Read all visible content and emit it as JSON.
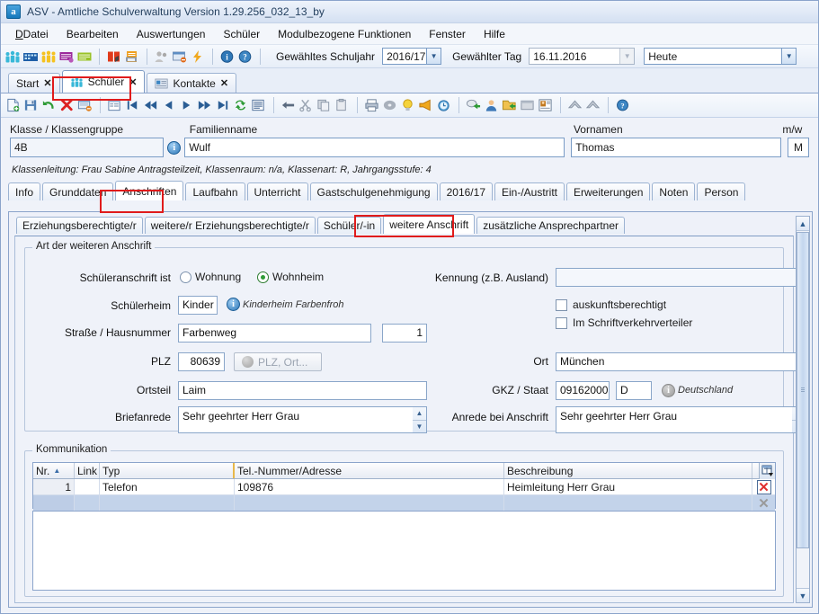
{
  "window": {
    "title": "ASV - Amtliche Schulverwaltung Version 1.29.256_032_13_by",
    "app_icon": "a"
  },
  "menubar": {
    "items": [
      {
        "label": "Datei",
        "mnemonic": "D"
      },
      {
        "label": "Bearbeiten",
        "mnemonic": "B"
      },
      {
        "label": "Auswertungen",
        "mnemonic": "A"
      },
      {
        "label": "Schüler",
        "mnemonic": "r"
      },
      {
        "label": "Modulbezogene Funktionen",
        "mnemonic": "M"
      },
      {
        "label": "Fenster",
        "mnemonic": "F"
      },
      {
        "label": "Hilfe",
        "mnemonic": "H"
      }
    ]
  },
  "toolbar_main": {
    "icons": [
      "students-group-icon",
      "school-building-icon",
      "persons-icon",
      "purple-card-icon",
      "green-note-icon",
      "red-book-icon",
      "print-report-icon",
      "grey-users-icon",
      "window-delete-icon",
      "lightning-icon",
      "info-icon",
      "help-icon"
    ],
    "schuljahr_label": "Gewähltes Schuljahr",
    "schuljahr_value": "2016/17",
    "tag_label": "Gewählter Tag",
    "tag_value": "16.11.2016",
    "period_value": "Heute"
  },
  "doc_tabs": [
    {
      "label": "Start",
      "icon": "",
      "active": false,
      "closable": true
    },
    {
      "label": "Schüler",
      "icon": "students-group-icon",
      "active": true,
      "closable": true,
      "highlighted": true
    },
    {
      "label": "Kontakte",
      "icon": "contact-card-icon",
      "active": false,
      "closable": true
    }
  ],
  "toolbar_record": {
    "icons": [
      "new-document-icon",
      "save-icon",
      "undo-icon",
      "delete-icon",
      "remove-row-icon",
      "list-icon",
      "first-record-icon",
      "prev-page-icon",
      "prev-record-icon",
      "next-record-icon",
      "next-page-icon",
      "last-record-icon",
      "refresh-icon",
      "report-icon",
      "back-arrow-icon",
      "cut-icon",
      "copy-icon",
      "paste-icon",
      "print-icon",
      "cd-icon",
      "bulb-icon",
      "horn-icon",
      "alarm-clock-icon",
      "export-icon",
      "user-icon",
      "folder-export-icon",
      "window-icon",
      "contact-photo-icon",
      "up-filled-icon",
      "up-filled-icon-2",
      "help-circle-icon"
    ]
  },
  "header": {
    "klasse_label": "Klasse / Klassengruppe",
    "klasse_value": "4B",
    "familienname_label": "Familienname",
    "familienname_value": "Wulf",
    "vornamen_label": "Vornamen",
    "vornamen_value": "Thomas",
    "mw_label": "m/w",
    "mw_value": "M",
    "klassenleitung": "Klassenleitung: Frau Sabine Antragsteilzeit, Klassenraum: n/a, Klassenart: R, Jahrgangsstufe: 4"
  },
  "main_tabs": [
    {
      "label": "Info",
      "active": false
    },
    {
      "label": "Grunddaten",
      "active": false
    },
    {
      "label": "Anschriften",
      "active": true,
      "highlighted": true
    },
    {
      "label": "Laufbahn",
      "active": false
    },
    {
      "label": "Unterricht",
      "active": false
    },
    {
      "label": "Gastschulgenehmigung",
      "active": false
    },
    {
      "label": "2016/17",
      "active": false
    },
    {
      "label": "Ein-/Austritt",
      "active": false
    },
    {
      "label": "Erweiterungen",
      "active": false
    },
    {
      "label": "Noten",
      "active": false
    },
    {
      "label": "Person",
      "active": false
    }
  ],
  "sub_tabs": [
    {
      "label": "Erziehungsberechtigte/r",
      "active": false
    },
    {
      "label": "weitere/r Erziehungsberechtigte/r",
      "active": false
    },
    {
      "label": "Schüler/-in",
      "active": false
    },
    {
      "label": "weitere Anschrift",
      "active": true,
      "highlighted": true
    },
    {
      "label": "zusätzliche Ansprechpartner",
      "active": false
    }
  ],
  "form": {
    "group_legend": "Art der weiteren Anschrift",
    "schueleranschrift_label": "Schüleranschrift ist",
    "radio_wohnung": {
      "label": "Wohnung",
      "selected": false
    },
    "radio_wohnheim": {
      "label": "Wohnheim",
      "selected": true
    },
    "schuelerheim_label": "Schülerheim",
    "schuelerheim_value": "Kinder",
    "schuelerheim_note": "Kinderheim Farbenfroh",
    "strasse_label": "Straße / Hausnummer",
    "strasse_value": "Farbenweg",
    "hausnummer_value": "1",
    "plz_label": "PLZ",
    "plz_value": "80639",
    "plz_button_label": "PLZ, Ort...",
    "ortsteil_label": "Ortsteil",
    "ortsteil_value": "Laim",
    "briefanrede_label": "Briefanrede",
    "briefanrede_value": "Sehr geehrter Herr Grau",
    "kennung_label": "Kennung (z.B. Ausland)",
    "kennung_value": "",
    "chk_auskunftsberechtigt": {
      "label": "auskunftsberechtigt",
      "checked": false
    },
    "chk_schriftverkehrverteiler": {
      "label": "Im Schriftverkehrverteiler",
      "checked": false
    },
    "ort_label": "Ort",
    "ort_value": "München",
    "gkz_label": "GKZ / Staat",
    "gkz_value": "09162000",
    "staat_value": "D",
    "staat_note": "Deutschland",
    "anrede_label": "Anrede bei Anschrift",
    "anrede_value": "Sehr geehrter Herr Grau"
  },
  "kommunikation": {
    "legend": "Kommunikation",
    "columns": [
      "Nr.",
      "Link",
      "Typ",
      "Tel.-Nummer/Adresse",
      "Beschreibung"
    ],
    "sort_column": "Nr.",
    "sort_direction": "asc",
    "rows": [
      {
        "nr": "1",
        "link": "",
        "typ": "Telefon",
        "nummer": "109876",
        "beschreibung": "Heimleitung Herr Grau",
        "delete_icon": "delete-row-red-icon"
      },
      {
        "nr": "",
        "link": "",
        "typ": "",
        "nummer": "",
        "beschreibung": "",
        "delete_icon": "delete-row-grey-icon"
      }
    ],
    "table_settings_icon": "table-settings-icon"
  },
  "colors": {
    "accent": "#2f78b8",
    "highlight_red": "#e01b1b",
    "panel_bg": "#eff2f9",
    "selected_row": "#c3d3ea"
  }
}
